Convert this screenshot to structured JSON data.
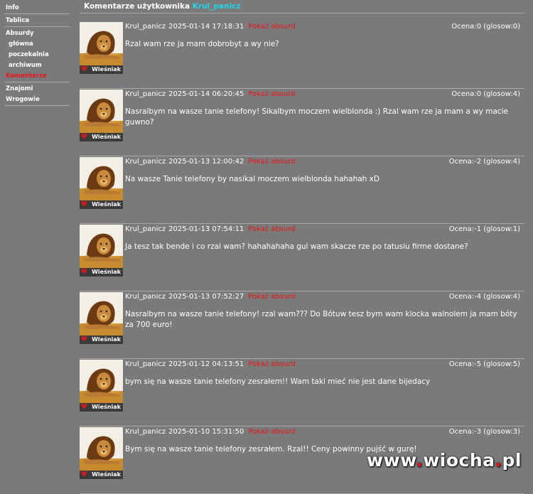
{
  "sidebar": {
    "items": [
      {
        "label": "Info",
        "sub": false,
        "sep": true,
        "active": false
      },
      {
        "label": "Tablica",
        "sub": false,
        "sep": true,
        "active": false
      },
      {
        "label": "Absurdy",
        "sub": false,
        "sep": false,
        "active": false
      },
      {
        "label": "główna",
        "sub": true,
        "sep": false,
        "active": false
      },
      {
        "label": "poczekalnia",
        "sub": true,
        "sep": false,
        "active": false
      },
      {
        "label": "archiwum",
        "sub": true,
        "sep": false,
        "active": false
      },
      {
        "label": "Komentarze",
        "sub": false,
        "sep": true,
        "active": true
      },
      {
        "label": "Znajomi",
        "sub": false,
        "sep": false,
        "active": false
      },
      {
        "label": "Wrogowie",
        "sub": false,
        "sep": true,
        "active": false
      }
    ]
  },
  "header": {
    "prefix": "Komentarze użytkownika ",
    "username": "Krul_panicz"
  },
  "comments": [
    {
      "user": "Krul_panicz",
      "date": "2025-01-14 17:18:31",
      "absurd_label": "Pokaż absurd",
      "rating": "Ocena:0 (glosow:0)",
      "text": "Rzal wam rze ja mam dobrobyt a wy nie?",
      "badge": "Wieśniak"
    },
    {
      "user": "Krul_panicz",
      "date": "2025-01-14 06:20:45",
      "absurd_label": "Pokaż absurd",
      "rating": "Ocena:0 (glosow:4)",
      "text": "Nasralbym na wasze tanie telefony! Sikalbym moczem wielblonda :) Rzal wam rze ja mam a wy macie guwno?",
      "badge": "Wieśniak"
    },
    {
      "user": "Krul_panicz",
      "date": "2025-01-13 12:00:42",
      "absurd_label": "Pokaż absurd",
      "rating": "Ocena:-2 (glosow:4)",
      "text": "Na wasze Tanie telefony by nasikal moczem wielblonda hahahah xD",
      "badge": "Wieśniak"
    },
    {
      "user": "Krul_panicz",
      "date": "2025-01-13 07:54:11",
      "absurd_label": "Pokaż absurd",
      "rating": "Ocena:-1 (glosow:1)",
      "text": "Ja tesz tak bende i co rzal wam? hahahahaha gul wam skacze rze po tatusiu firme dostane?",
      "badge": "Wieśniak"
    },
    {
      "user": "Krul_panicz",
      "date": "2025-01-13 07:52:27",
      "absurd_label": "Pokaż absurd",
      "rating": "Ocena:-4 (glosow:4)",
      "text": "Nasralbym na wasze tanie telefony! rzal wam??? Do Bótuw tesz bym wam klocka walnolem ja mam bóty za 700 euro!",
      "badge": "Wieśniak"
    },
    {
      "user": "Krul_panicz",
      "date": "2025-01-12 04:13:51",
      "absurd_label": "Pokaż absurd",
      "rating": "Ocena:-5 (glosow:5)",
      "text": "bym się na wasze tanie telefony zesrałem!! Wam taki mieć nie jest dane bijedacy",
      "badge": "Wieśniak"
    },
    {
      "user": "Krul_panicz",
      "date": "2025-01-10 15:31:50",
      "absurd_label": "Pokaż absurd",
      "rating": "Ocena:-3 (glosow:3)",
      "text": "Bym się na wasze tanie telefony zesrałem. Rzal!! Ceny powinny pujść w gurę!",
      "badge": "Wieśniak"
    }
  ],
  "watermark": {
    "part1": "www",
    "dot1": ".",
    "part2": "wiocha",
    "dot2": ".",
    "part3": "pl"
  },
  "colors": {
    "background": "#7a7a7a",
    "accent_red": "#e8151a",
    "link_cyan": "#22d4e8"
  }
}
